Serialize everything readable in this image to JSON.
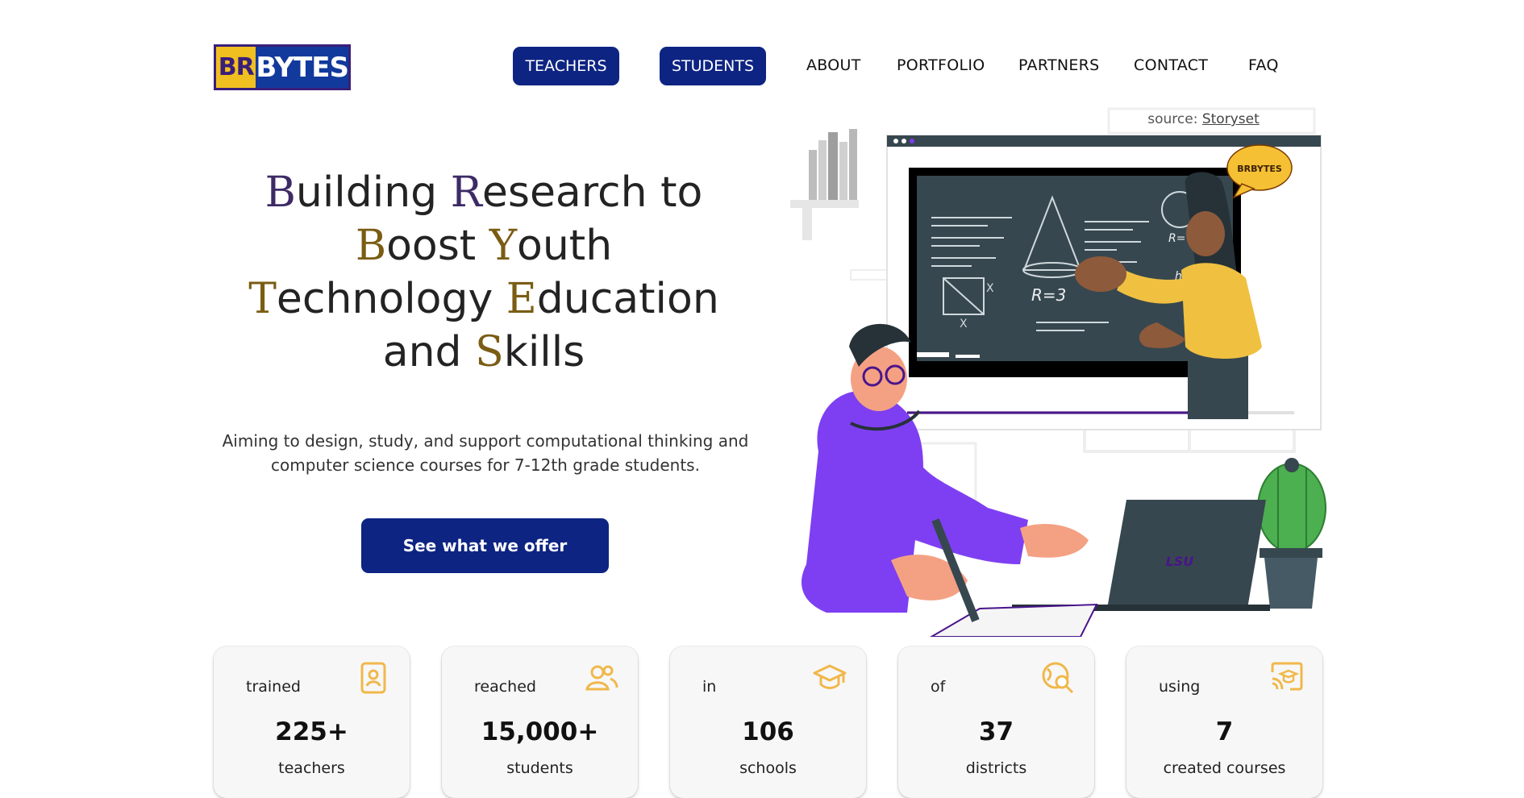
{
  "logo": {
    "part1": "BR",
    "part2": "BYTES"
  },
  "nav": {
    "buttons": [
      {
        "label": "TEACHERS"
      },
      {
        "label": "STUDENTS"
      }
    ],
    "links": [
      {
        "label": "ABOUT"
      },
      {
        "label": "PORTFOLIO"
      },
      {
        "label": "PARTNERS"
      },
      {
        "label": "CONTACT"
      },
      {
        "label": "FAQ"
      }
    ]
  },
  "hero": {
    "title_lines": [
      [
        {
          "cap": "B",
          "rest": "uilding "
        },
        {
          "cap": "R",
          "rest": "esearch to"
        }
      ],
      [
        {
          "cap": "B",
          "rest": "oost "
        },
        {
          "cap": "Y",
          "rest": "outh"
        }
      ],
      [
        {
          "cap": "T",
          "rest": "echnology "
        },
        {
          "cap": "E",
          "rest": "ducation"
        }
      ],
      [
        {
          "cap": "",
          "rest": "and "
        },
        {
          "cap": "S",
          "rest": "kills"
        }
      ]
    ],
    "subtitle": "Aiming to design, study, and support computational thinking and computer science courses for 7-12th grade students.",
    "cta_label": "See what we offer"
  },
  "illustration": {
    "source_label": "source:",
    "source_link": "Storyset",
    "bubble_text": "BRBYTES",
    "board_text_1": "R= 10",
    "board_text_2": "R=3",
    "board_text_3": "h",
    "board_x_1": "X",
    "board_x_2": "X",
    "laptop_text": "LSU"
  },
  "stats": [
    {
      "pre": "trained",
      "value": "225+",
      "unit": "teachers",
      "icon": "id-badge-icon"
    },
    {
      "pre": "reached",
      "value": "15,000+",
      "unit": "students",
      "icon": "users-icon"
    },
    {
      "pre": "in",
      "value": "106",
      "unit": "schools",
      "icon": "graduation-cap-icon"
    },
    {
      "pre": "of",
      "value": "37",
      "unit": "districts",
      "icon": "globe-search-icon"
    },
    {
      "pre": "using",
      "value": "7",
      "unit": "created courses",
      "icon": "cast-course-icon"
    }
  ],
  "colors": {
    "navy": "#0e2483",
    "gold": "#f0b84a",
    "purple": "#3d2a66",
    "violet": "#7c3aed"
  }
}
